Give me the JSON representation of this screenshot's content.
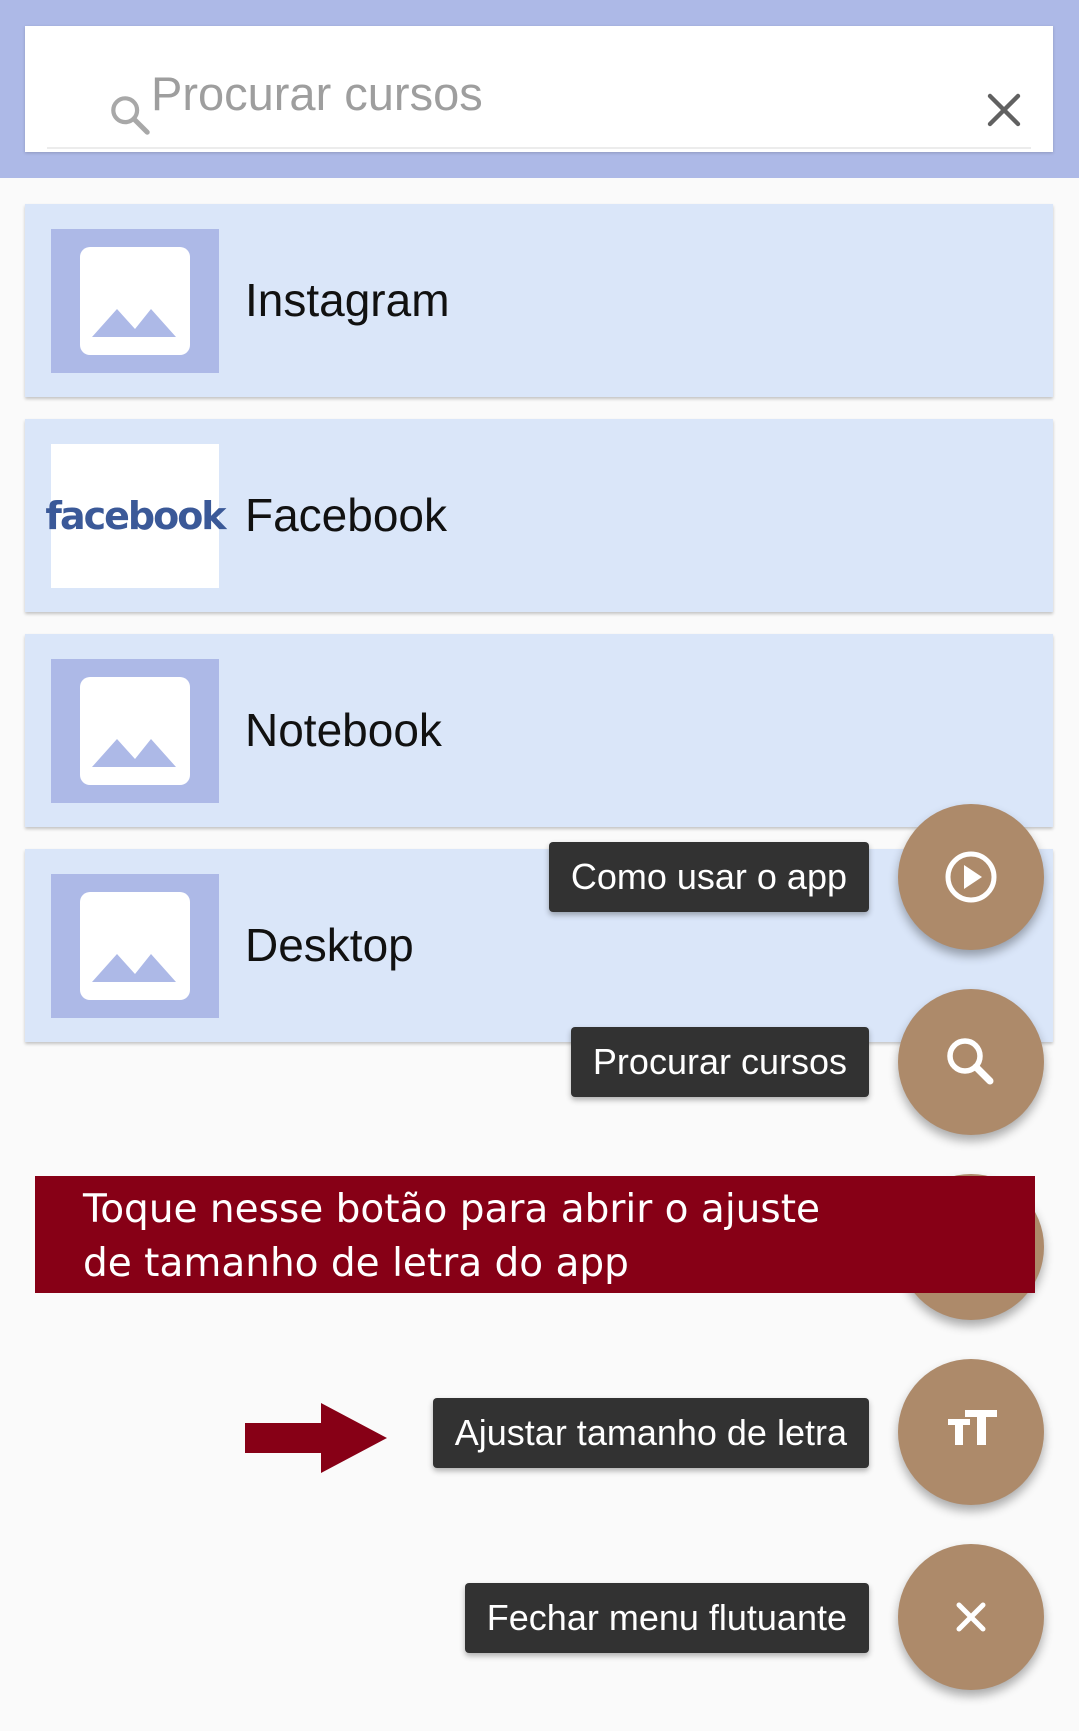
{
  "search": {
    "placeholder": "Procurar cursos",
    "search_icon": "search-icon",
    "clear_icon": "close-icon"
  },
  "courses": [
    {
      "title": "Instagram",
      "thumbnail": "image-placeholder-icon"
    },
    {
      "title": "Facebook",
      "thumbnail": "facebook-logo",
      "logo_text": "facebook"
    },
    {
      "title": "Notebook",
      "thumbnail": "image-placeholder-icon"
    },
    {
      "title": "Desktop",
      "thumbnail": "image-placeholder-icon"
    }
  ],
  "fab_menu": {
    "how_to_use": {
      "label": "Como usar o app",
      "icon": "play-circle-icon"
    },
    "search_courses": {
      "label": "Procurar cursos",
      "icon": "search-icon"
    },
    "font_size": {
      "label": "Ajustar tamanho de letra",
      "icon": "text-size-icon"
    },
    "close_menu": {
      "label": "Fechar menu flutuante",
      "icon": "close-icon"
    }
  },
  "annotation": {
    "line1": "Toque nesse botão para abrir o ajuste",
    "line2": "de tamanho de letra do app",
    "arrow_icon": "arrow-right-icon"
  },
  "colors": {
    "header": "#adb9e7",
    "card": "#dae6f9",
    "fab": "#ad8a6a",
    "tooltip": "#323232",
    "annotation": "#870016"
  }
}
